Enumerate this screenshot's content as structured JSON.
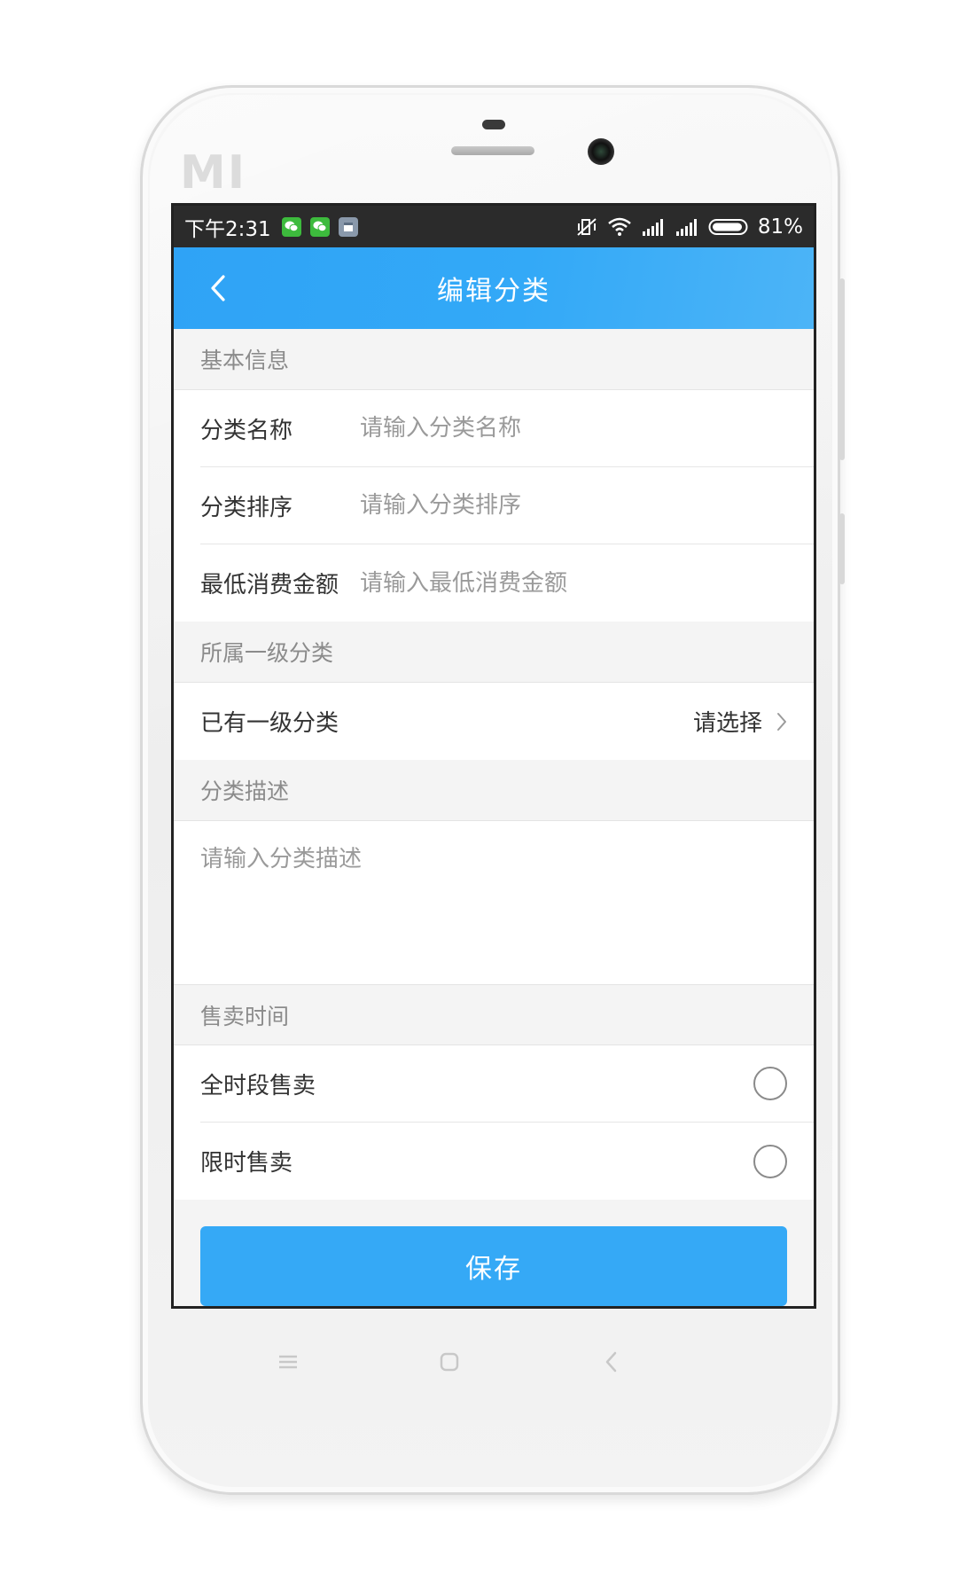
{
  "device": {
    "brand_logo": "MI"
  },
  "status_bar": {
    "time": "下午2:31",
    "battery_percent": "81%",
    "icons": [
      "wechat-icon",
      "wechat-icon",
      "document-icon",
      "mute-vibrate-icon",
      "wifi-icon",
      "signal-icon",
      "signal-icon",
      "battery-icon"
    ]
  },
  "header": {
    "title": "编辑分类",
    "back_icon": "chevron-left-icon"
  },
  "sections": {
    "basic_info": {
      "title": "基本信息",
      "fields": [
        {
          "label": "分类名称",
          "value": "",
          "placeholder": "请输入分类名称"
        },
        {
          "label": "分类排序",
          "value": "",
          "placeholder": "请输入分类排序"
        },
        {
          "label": "最低消费金额",
          "value": "",
          "placeholder": "请输入最低消费金额"
        }
      ]
    },
    "parent_category": {
      "title": "所属一级分类",
      "select_label": "已有一级分类",
      "select_value": "请选择"
    },
    "description": {
      "title": "分类描述",
      "value": "",
      "placeholder": "请输入分类描述"
    },
    "sale_time": {
      "title": "售卖时间",
      "options": [
        {
          "label": "全时段售卖",
          "selected": false
        },
        {
          "label": "限时售卖",
          "selected": false
        }
      ]
    }
  },
  "actions": {
    "save_label": "保存"
  },
  "colors": {
    "accent": "#35a9f6",
    "status_bar": "#2b2b2b",
    "background": "#f4f4f4"
  }
}
